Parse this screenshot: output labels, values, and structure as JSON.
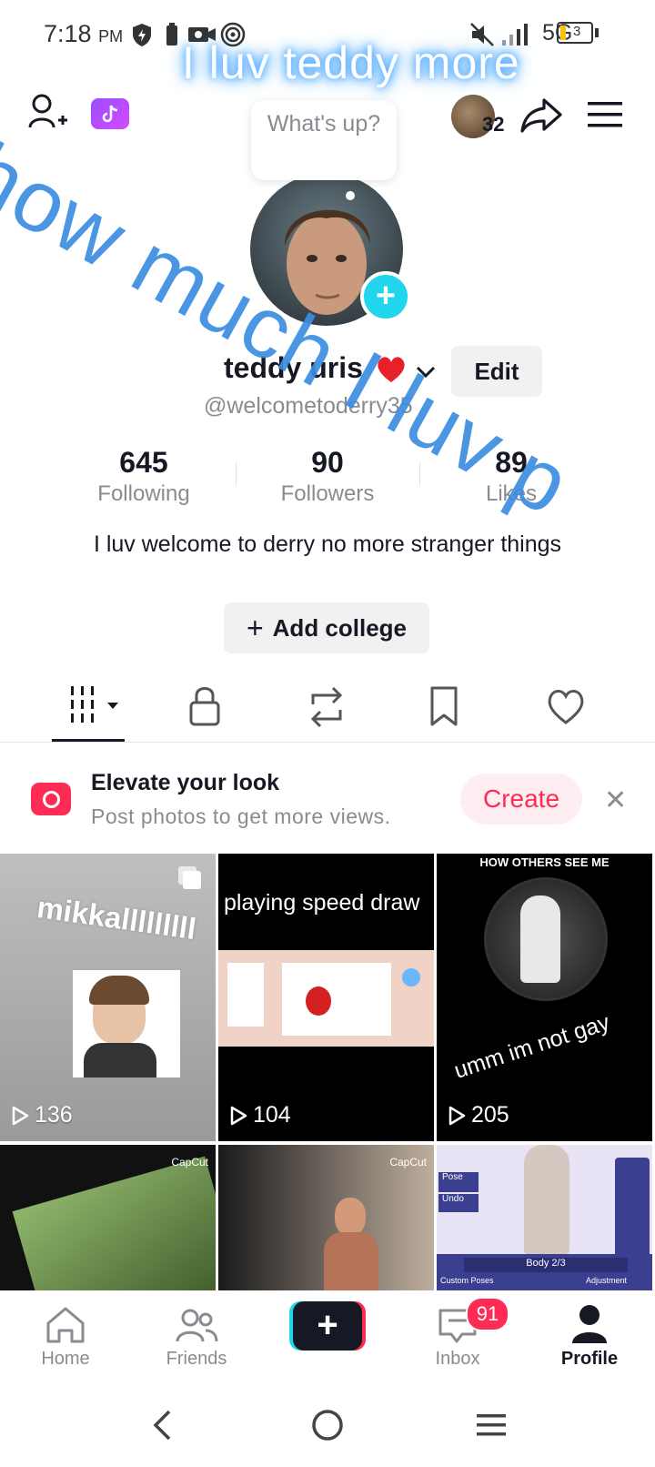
{
  "status_bar": {
    "time": "7:18",
    "ampm": "PM",
    "network": "5G",
    "battery": "3"
  },
  "header": {
    "whats_up": "What's up?",
    "notification_count": "32"
  },
  "overlay": {
    "top_text": "I luv teddy more",
    "diagonal_text": "how much I luv p"
  },
  "profile": {
    "display_name": "teddy uris",
    "username": "@welcometoderry35",
    "edit_label": "Edit",
    "stats": [
      {
        "value": "645",
        "label": "Following"
      },
      {
        "value": "90",
        "label": "Followers"
      },
      {
        "value": "89",
        "label": "Likes"
      }
    ],
    "bio": "I luv welcome to derry no more stranger things",
    "add_college": "Add college"
  },
  "tabs": [
    "videos",
    "private",
    "reposts",
    "favorites",
    "liked"
  ],
  "promo": {
    "title": "Elevate your look",
    "subtitle": "Post photos to get more views.",
    "create_label": "Create"
  },
  "grid": [
    {
      "overlay": "mikkalllllllll",
      "views": "136"
    },
    {
      "overlay": "playing speed draw",
      "views": "104"
    },
    {
      "overlay_top": "HOW OTHERS SEE ME",
      "overlay": "umm im not gay",
      "views": "205"
    },
    {
      "overlay": "",
      "views": "",
      "badge": "CapCut"
    },
    {
      "overlay": "",
      "views": "",
      "badge": "CapCut"
    },
    {
      "overlay": "Body 2/3",
      "views": "",
      "menu": [
        "Pose",
        "Undo",
        "Custom Poses",
        "Adjustment"
      ]
    }
  ],
  "bottom_nav": [
    {
      "label": "Home"
    },
    {
      "label": "Friends"
    },
    {
      "label": ""
    },
    {
      "label": "Inbox",
      "badge": "91"
    },
    {
      "label": "Profile"
    }
  ],
  "colors": {
    "accent": "#fe2c55",
    "cyan": "#20d5ec",
    "overlay_blue": "#3b8ee0"
  }
}
